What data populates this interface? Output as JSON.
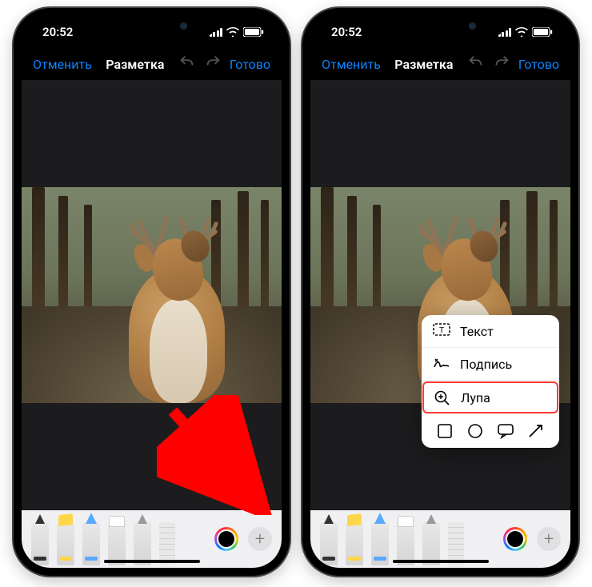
{
  "status": {
    "time": "20:52"
  },
  "nav": {
    "cancel": "Отменить",
    "title": "Разметка",
    "done": "Готово"
  },
  "popup": {
    "text": "Текст",
    "signature": "Подпись",
    "magnifier": "Лупа"
  },
  "colors": {
    "link": "#0a84ff",
    "arrow": "#ff0000",
    "highlight_box": "#ff3b30"
  }
}
